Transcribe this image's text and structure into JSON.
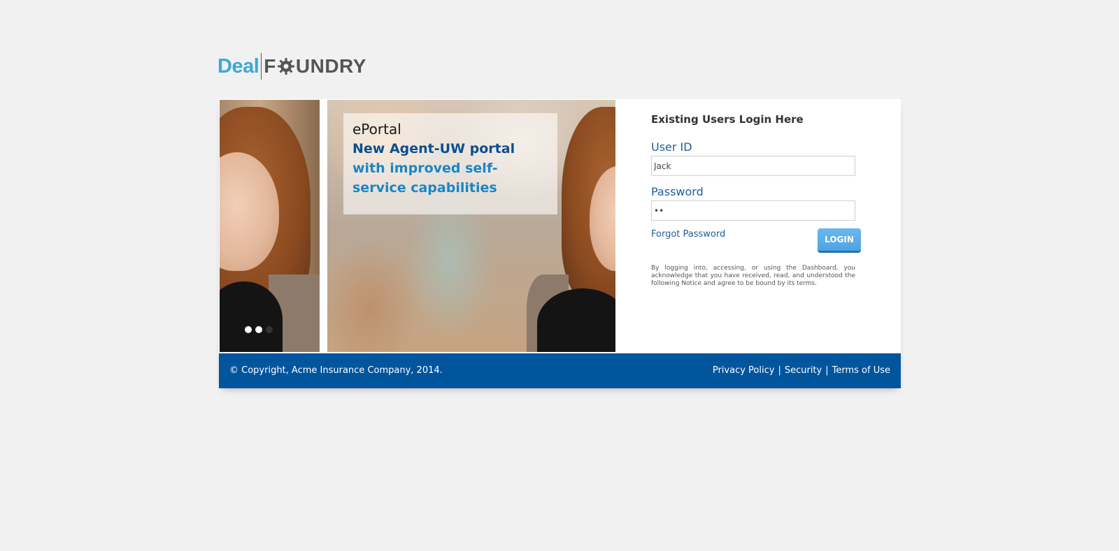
{
  "logo": {
    "deal": "Deal",
    "foundry_prefix": "F",
    "foundry_suffix": "UNDRY"
  },
  "carousel": {
    "title": "ePortal",
    "line1": "New Agent-UW portal",
    "line2": "with improved self-service capabilities",
    "dots": [
      "active",
      "active",
      "inactive"
    ]
  },
  "login": {
    "heading": "Existing Users Login Here",
    "user_id_label": "User ID",
    "user_id_value": "Jack",
    "password_label": "Password",
    "password_value": "••",
    "forgot_label": "Forgot Password",
    "login_button": "LOGIN",
    "legal_text": "By logging into, accessing, or using the Dashboard, you acknowledge that you have received, read, and understood the following Notice and agree to be bound by its terms."
  },
  "footer": {
    "copyright": "© Copyright, Acme Insurance Company, 2014.",
    "links": [
      "Privacy Policy",
      "Security",
      "Terms of Use"
    ],
    "separator": "|"
  },
  "colors": {
    "background": "#f1f1f1",
    "footer": "#00559d",
    "accent_blue": "#1d5e9e",
    "logo_blue": "#3ba8d8",
    "button": "#4fa3e3"
  }
}
